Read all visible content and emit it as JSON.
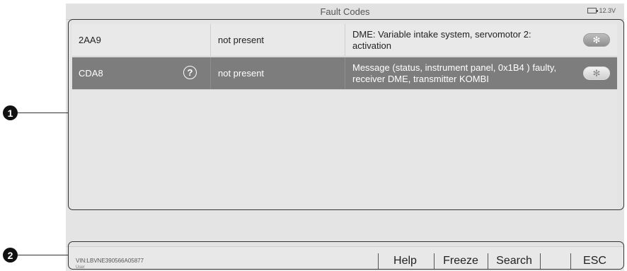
{
  "header": {
    "title": "Fault Codes",
    "battery_voltage": "12.3V"
  },
  "fault_codes": [
    {
      "code": "2AA9",
      "status": "not present",
      "description": "DME: Variable intake system, servomotor 2: activation",
      "has_help": false,
      "freeze_icon": "✻"
    },
    {
      "code": "CDA8",
      "status": "not present",
      "description": "Message (status, instrument panel, 0x1B4 ) faulty, receiver DME, transmitter KOMBI",
      "has_help": true,
      "help_icon": "?",
      "freeze_icon": "✻"
    }
  ],
  "footer": {
    "vin": "VIN:LBVNE390566A05877",
    "user": "User",
    "buttons": {
      "help": "Help",
      "freeze": "Freeze",
      "search": "Search",
      "esc": "ESC"
    }
  },
  "callouts": [
    "1",
    "2"
  ]
}
